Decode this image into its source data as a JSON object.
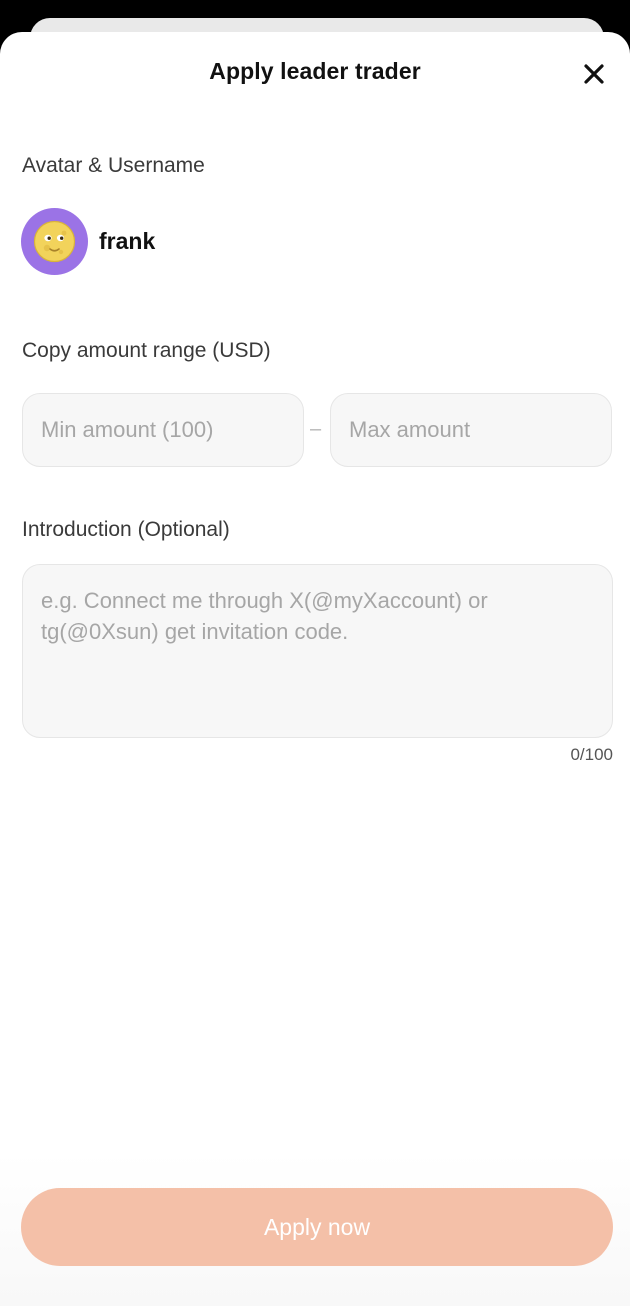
{
  "header": {
    "title": "Apply leader trader",
    "close_icon": "close-icon"
  },
  "profile": {
    "section_label": "Avatar & Username",
    "avatar_icon": "full-moon-face-icon",
    "username": "frank"
  },
  "amount_range": {
    "section_label": "Copy amount range (USD)",
    "min_placeholder": "Min amount (100)",
    "max_placeholder": "Max amount",
    "min_value": "",
    "max_value": "",
    "separator": "–"
  },
  "introduction": {
    "section_label": "Introduction (Optional)",
    "placeholder": "e.g. Connect me through X(@myXaccount) or tg(@0Xsun) get invitation code.",
    "value": "",
    "counter": "0/100"
  },
  "footer": {
    "apply_label": "Apply now"
  },
  "colors": {
    "avatar_bg": "#9b73e6",
    "apply_button_bg": "#f4c0a8",
    "apply_button_text": "#ffffff"
  }
}
